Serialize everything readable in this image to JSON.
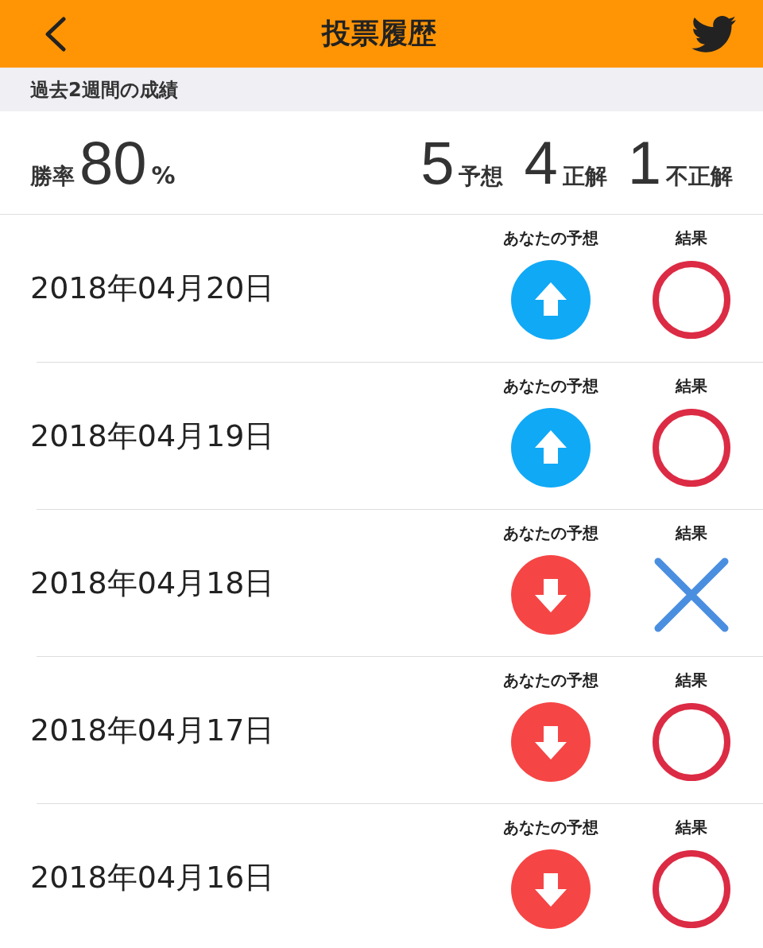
{
  "header": {
    "title": "投票履歴"
  },
  "section": {
    "title": "過去2週間の成績"
  },
  "stats": {
    "rate_label": "勝率",
    "rate_value": "80",
    "rate_unit": "%",
    "counts": [
      {
        "value": "5",
        "unit": "予想"
      },
      {
        "value": "4",
        "unit": "正解"
      },
      {
        "value": "1",
        "unit": "不正解"
      }
    ]
  },
  "rows": [
    {
      "date": "2018年04月20日",
      "prediction_label": "あなたの予想",
      "predicted_up": true,
      "result_label": "結果",
      "correct": true
    },
    {
      "date": "2018年04月19日",
      "prediction_label": "あなたの予想",
      "predicted_up": true,
      "result_label": "結果",
      "correct": true
    },
    {
      "date": "2018年04月18日",
      "prediction_label": "あなたの予想",
      "predicted_up": false,
      "result_label": "結果",
      "correct": false
    },
    {
      "date": "2018年04月17日",
      "prediction_label": "あなたの予想",
      "predicted_up": false,
      "result_label": "結果",
      "correct": true
    },
    {
      "date": "2018年04月16日",
      "prediction_label": "あなたの予想",
      "predicted_up": false,
      "result_label": "結果",
      "correct": true
    }
  ]
}
